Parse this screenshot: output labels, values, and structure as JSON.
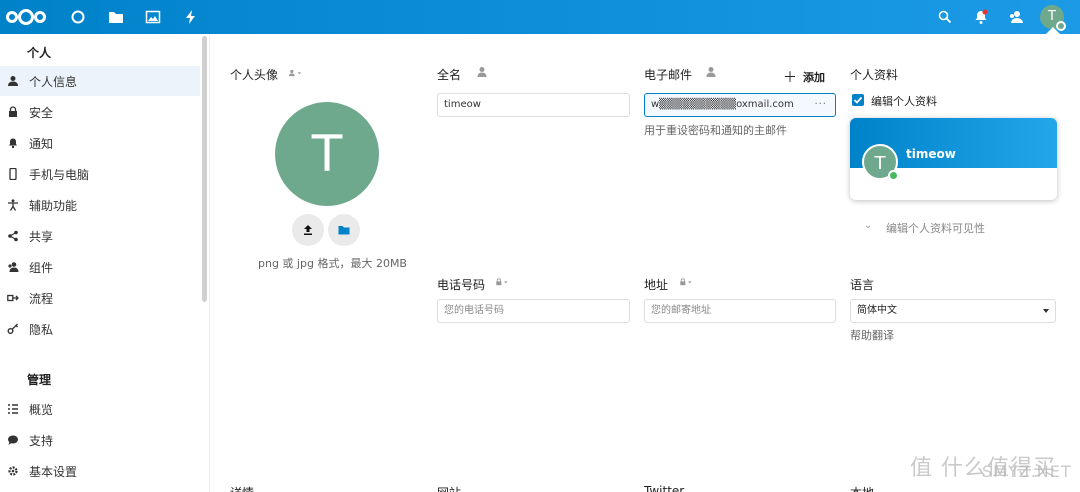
{
  "header": {
    "avatar_letter": "T",
    "icons": [
      "nextcloud-logo",
      "dashboard-icon",
      "files-icon",
      "photos-icon",
      "activity-icon",
      "search-icon",
      "notifications-icon",
      "contacts-icon"
    ],
    "accent": "#0082c9"
  },
  "sidebar": {
    "section_personal": "个人",
    "items": [
      {
        "label": "个人信息",
        "icon": "user-icon"
      },
      {
        "label": "安全",
        "icon": "lock-icon"
      },
      {
        "label": "通知",
        "icon": "bell-icon"
      },
      {
        "label": "手机与电脑",
        "icon": "phone-icon"
      },
      {
        "label": "辅助功能",
        "icon": "accessibility-icon"
      },
      {
        "label": "共享",
        "icon": "share-icon"
      },
      {
        "label": "组件",
        "icon": "group-icon"
      },
      {
        "label": "流程",
        "icon": "flow-icon"
      },
      {
        "label": "隐私",
        "icon": "key-icon"
      }
    ],
    "section_admin": "管理",
    "admin_items": [
      {
        "label": "概览",
        "icon": "list-icon"
      },
      {
        "label": "支持",
        "icon": "chat-icon"
      },
      {
        "label": "基本设置",
        "icon": "gear-icon"
      }
    ]
  },
  "profile": {
    "avatar_title": "个人头像",
    "avatar_letter": "T",
    "avatar_hint": "png 或 jpg 格式，最大 20MB",
    "fullname_label": "全名",
    "fullname_value": "timeow",
    "email_label": "电子邮件",
    "email_add": "添加",
    "email_value": "w▒▒▒▒▒▒▒▒▒▒oxmail.com",
    "email_hint": "用于重设密码和通知的主邮件",
    "profile_label": "个人资料",
    "edit_profile": "编辑个人资料",
    "card_name": "timeow",
    "card_avatar": "T",
    "visibility": "编辑个人资料可见性",
    "phone_label": "电话号码",
    "phone_placeholder": "您的电话号码",
    "address_label": "地址",
    "address_placeholder": "您的邮寄地址",
    "language_label": "语言",
    "language_value": "简体中文",
    "help_translate": "帮助翻译",
    "bottom_labels": [
      "详情",
      "网站",
      "Twitter",
      "本地"
    ]
  },
  "watermark": {
    "text": "值 什么值得买",
    "site": "SMYZ.NET"
  }
}
